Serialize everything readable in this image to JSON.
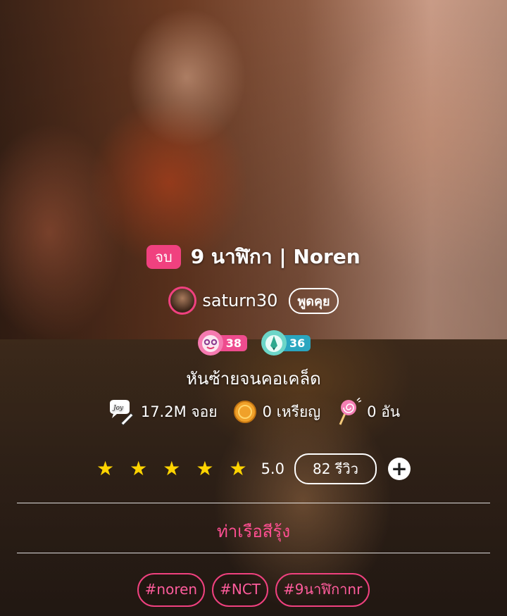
{
  "story": {
    "status_badge": "จบ",
    "title": "9 นาฬิกา | Noren",
    "author": "saturn30",
    "chat_label": "พูดคุย",
    "tagline": "หันซ้ายจนคอเคล็ด",
    "fandom": "ท่าเรือสีรุ้ง"
  },
  "badges": [
    {
      "icon": "smiling-face-badge-icon",
      "count": "38",
      "color": "#ee4c8e"
    },
    {
      "icon": "pencil-badge-icon",
      "count": "36",
      "color": "#2aa6c0"
    }
  ],
  "stats": {
    "joy": "17.2M จอย",
    "coins": "0 เหรียญ",
    "candies": "0 อัน"
  },
  "rating": {
    "stars": 5,
    "value": "5.0",
    "reviews": "82 รีวิว"
  },
  "tags": [
    "#noren",
    "#NCT",
    "#9นาฬิกาnr"
  ],
  "colors": {
    "accent": "#f0417f",
    "star": "#ffd400"
  }
}
